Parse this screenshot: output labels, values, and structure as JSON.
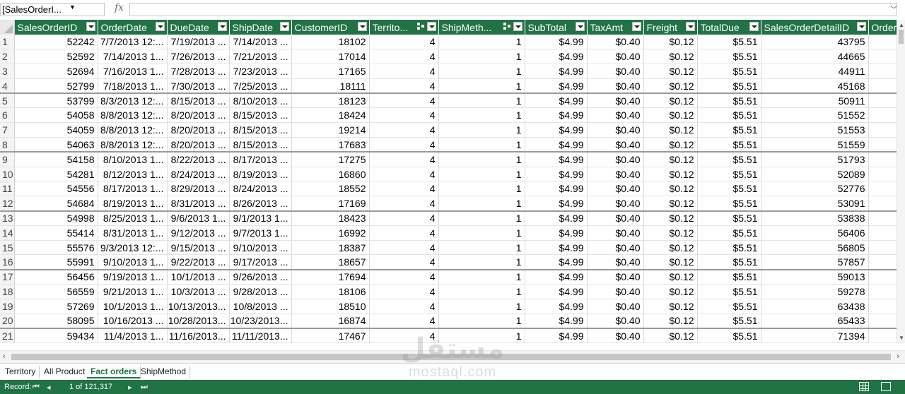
{
  "formula_bar": {
    "namebox": "[SalesOrderI...",
    "fx_label": "fx",
    "formula": ""
  },
  "columns": [
    {
      "label": "SalesOrderID",
      "relationship": false
    },
    {
      "label": "OrderDate",
      "relationship": false
    },
    {
      "label": "DueDate",
      "relationship": false
    },
    {
      "label": "ShipDate",
      "relationship": false
    },
    {
      "label": "CustomerID",
      "relationship": false
    },
    {
      "label": "Territo...",
      "relationship": true
    },
    {
      "label": "ShipMeth...",
      "relationship": true
    },
    {
      "label": "SubTotal",
      "relationship": false
    },
    {
      "label": "TaxAmt",
      "relationship": false
    },
    {
      "label": "Freight",
      "relationship": false
    },
    {
      "label": "TotalDue",
      "relationship": false
    },
    {
      "label": "SalesOrderDetailID",
      "relationship": false
    },
    {
      "label": "Order",
      "relationship": false
    }
  ],
  "rows": [
    {
      "n": "1",
      "cells": [
        "52242",
        "7/7/2013 12:...",
        "7/19/2013 ...",
        "7/14/2013 ...",
        "18102",
        "4",
        "1",
        "$4.99",
        "$0.40",
        "$0.12",
        "$5.51",
        "43795",
        ""
      ]
    },
    {
      "n": "2",
      "cells": [
        "52592",
        "7/14/2013 1...",
        "7/26/2013 ...",
        "7/21/2013 ...",
        "17014",
        "4",
        "1",
        "$4.99",
        "$0.40",
        "$0.12",
        "$5.51",
        "44665",
        ""
      ]
    },
    {
      "n": "3",
      "cells": [
        "52694",
        "7/16/2013 1...",
        "7/28/2013 ...",
        "7/23/2013 ...",
        "17165",
        "4",
        "1",
        "$4.99",
        "$0.40",
        "$0.12",
        "$5.51",
        "44911",
        ""
      ]
    },
    {
      "n": "4",
      "cells": [
        "52799",
        "7/18/2013 1...",
        "7/30/2013 ...",
        "7/25/2013 ...",
        "18111",
        "4",
        "1",
        "$4.99",
        "$0.40",
        "$0.12",
        "$5.51",
        "45168",
        ""
      ]
    },
    {
      "n": "5",
      "cells": [
        "53799",
        "8/3/2013 12:...",
        "8/15/2013 ...",
        "8/10/2013 ...",
        "18123",
        "4",
        "1",
        "$4.99",
        "$0.40",
        "$0.12",
        "$5.51",
        "50911",
        ""
      ]
    },
    {
      "n": "6",
      "cells": [
        "54058",
        "8/8/2013 12:...",
        "8/20/2013 ...",
        "8/15/2013 ...",
        "18424",
        "4",
        "1",
        "$4.99",
        "$0.40",
        "$0.12",
        "$5.51",
        "51552",
        ""
      ]
    },
    {
      "n": "7",
      "cells": [
        "54059",
        "8/8/2013 12:...",
        "8/20/2013 ...",
        "8/15/2013 ...",
        "19214",
        "4",
        "1",
        "$4.99",
        "$0.40",
        "$0.12",
        "$5.51",
        "51553",
        ""
      ]
    },
    {
      "n": "8",
      "cells": [
        "54063",
        "8/8/2013 12:...",
        "8/20/2013 ...",
        "8/15/2013 ...",
        "17683",
        "4",
        "1",
        "$4.99",
        "$0.40",
        "$0.12",
        "$5.51",
        "51559",
        ""
      ]
    },
    {
      "n": "9",
      "cells": [
        "54158",
        "8/10/2013 1...",
        "8/22/2013 ...",
        "8/17/2013 ...",
        "17275",
        "4",
        "1",
        "$4.99",
        "$0.40",
        "$0.12",
        "$5.51",
        "51793",
        ""
      ]
    },
    {
      "n": "10",
      "cells": [
        "54281",
        "8/12/2013 1...",
        "8/24/2013 ...",
        "8/19/2013 ...",
        "16860",
        "4",
        "1",
        "$4.99",
        "$0.40",
        "$0.12",
        "$5.51",
        "52089",
        ""
      ]
    },
    {
      "n": "11",
      "cells": [
        "54556",
        "8/17/2013 1...",
        "8/29/2013 ...",
        "8/24/2013 ...",
        "18552",
        "4",
        "1",
        "$4.99",
        "$0.40",
        "$0.12",
        "$5.51",
        "52776",
        ""
      ]
    },
    {
      "n": "12",
      "cells": [
        "54684",
        "8/19/2013 1...",
        "8/31/2013 ...",
        "8/26/2013 ...",
        "17169",
        "4",
        "1",
        "$4.99",
        "$0.40",
        "$0.12",
        "$5.51",
        "53091",
        ""
      ]
    },
    {
      "n": "13",
      "cells": [
        "54998",
        "8/25/2013 1...",
        "9/6/2013 1...",
        "9/1/2013 1...",
        "18423",
        "4",
        "1",
        "$4.99",
        "$0.40",
        "$0.12",
        "$5.51",
        "53838",
        ""
      ]
    },
    {
      "n": "14",
      "cells": [
        "55414",
        "8/31/2013 1...",
        "9/12/2013 ...",
        "9/7/2013 1...",
        "16992",
        "4",
        "1",
        "$4.99",
        "$0.40",
        "$0.12",
        "$5.51",
        "56406",
        ""
      ]
    },
    {
      "n": "15",
      "cells": [
        "55576",
        "9/3/2013 12:...",
        "9/15/2013 ...",
        "9/10/2013 ...",
        "18387",
        "4",
        "1",
        "$4.99",
        "$0.40",
        "$0.12",
        "$5.51",
        "56805",
        ""
      ]
    },
    {
      "n": "16",
      "cells": [
        "55991",
        "9/10/2013 1...",
        "9/22/2013 ...",
        "9/17/2013 ...",
        "18657",
        "4",
        "1",
        "$4.99",
        "$0.40",
        "$0.12",
        "$5.51",
        "57857",
        ""
      ]
    },
    {
      "n": "17",
      "cells": [
        "56456",
        "9/19/2013 1...",
        "10/1/2013 ...",
        "9/26/2013 ...",
        "17694",
        "4",
        "1",
        "$4.99",
        "$0.40",
        "$0.12",
        "$5.51",
        "59013",
        ""
      ]
    },
    {
      "n": "18",
      "cells": [
        "56559",
        "9/21/2013 1...",
        "10/3/2013 ...",
        "9/28/2013 ...",
        "18106",
        "4",
        "1",
        "$4.99",
        "$0.40",
        "$0.12",
        "$5.51",
        "59278",
        ""
      ]
    },
    {
      "n": "19",
      "cells": [
        "57269",
        "10/1/2013 1...",
        "10/13/2013...",
        "10/8/2013 ...",
        "18510",
        "4",
        "1",
        "$4.99",
        "$0.40",
        "$0.12",
        "$5.51",
        "63438",
        ""
      ]
    },
    {
      "n": "20",
      "cells": [
        "58095",
        "10/16/2013 ...",
        "10/28/2013...",
        "10/23/2013...",
        "16874",
        "4",
        "1",
        "$4.99",
        "$0.40",
        "$0.12",
        "$5.51",
        "65433",
        ""
      ]
    },
    {
      "n": "21",
      "cells": [
        "59434",
        "11/4/2013 1...",
        "11/16/2013...",
        "11/11/2013...",
        "17467",
        "4",
        "1",
        "$4.99",
        "$0.40",
        "$0.12",
        "$5.51",
        "71394",
        ""
      ]
    }
  ],
  "sheet_tabs": [
    {
      "label": "Territory",
      "active": false
    },
    {
      "label": "All Product",
      "active": false
    },
    {
      "label": "Fact orders",
      "active": true
    },
    {
      "label": "ShipMethod",
      "active": false
    }
  ],
  "status_bar": {
    "record_label": "Record:",
    "record_position": "1 of 121,317"
  },
  "watermark": {
    "arabic": "مستقل",
    "latin": "mostaql.com"
  },
  "colors": {
    "accent": "#217346",
    "header_text": "#ffffff",
    "grid_line": "#dadada"
  }
}
